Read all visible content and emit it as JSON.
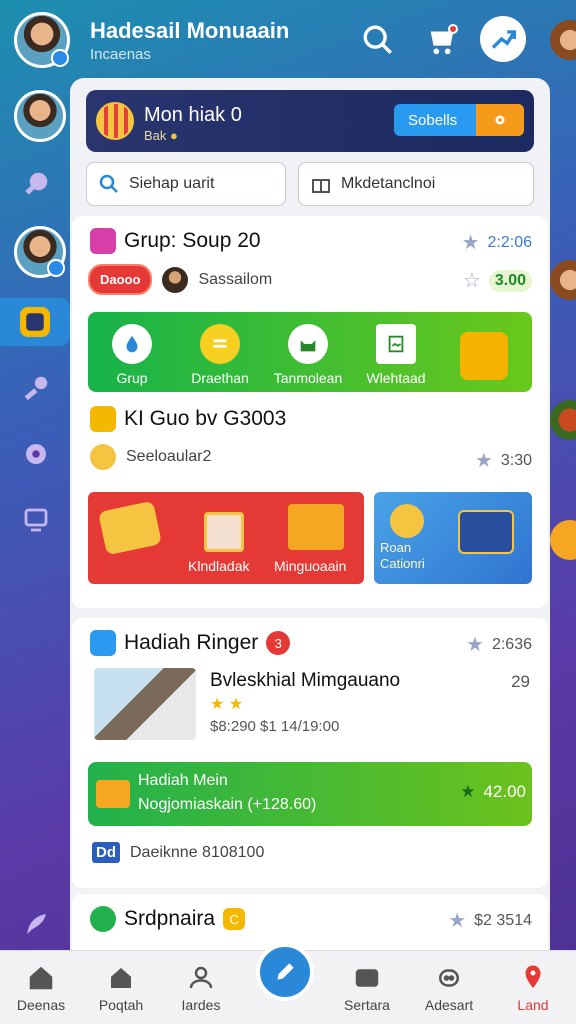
{
  "header": {
    "title": "Hadesail Monuaain",
    "subtitle": "Incaenas"
  },
  "promo": {
    "title": "Mon hiak 0",
    "subtitle": "Bak",
    "button": "Sobells"
  },
  "search": {
    "left": "Siehap uarit",
    "right": "Mkdetanclnoi"
  },
  "card1": {
    "title": "Grup: Soup 20",
    "time": "2:2:06",
    "pill": "Daooo",
    "user": "Sassailom",
    "score": "3.00",
    "banner": [
      "Grup",
      "Draethan",
      "Tanmolean",
      "Wlehtaad"
    ]
  },
  "card2": {
    "title": "KI Guo bv G3003",
    "user": "Seeloaular2",
    "score": "3:30",
    "promo_left": [
      "Klndladak",
      "Minguoaain"
    ],
    "promo_right": "Roan Cationri"
  },
  "card3": {
    "title": "Hadiah Ringer",
    "badge": "3",
    "time": "2:636",
    "item_title": "Bvleskhial Mimgauano",
    "item_num": "29",
    "item_price": "$8:290  $1 14/19:00",
    "bar_title": "Hadiah Mein",
    "bar_sub": "Nogjomiaskain (+128.60)",
    "bar_value": "42.00",
    "foot_tag": "Dd",
    "foot_text": "Daeiknne 8108100"
  },
  "card4": {
    "title": "Srdpnaira",
    "badge": "C",
    "value": "$2 3514"
  },
  "nav": [
    "Deenas",
    "Poqtah",
    "Iardes",
    "Sertara",
    "Adesart",
    "Land"
  ],
  "colors": {
    "accent": "#2a88d8",
    "red": "#e53935",
    "green": "#22b14c"
  }
}
